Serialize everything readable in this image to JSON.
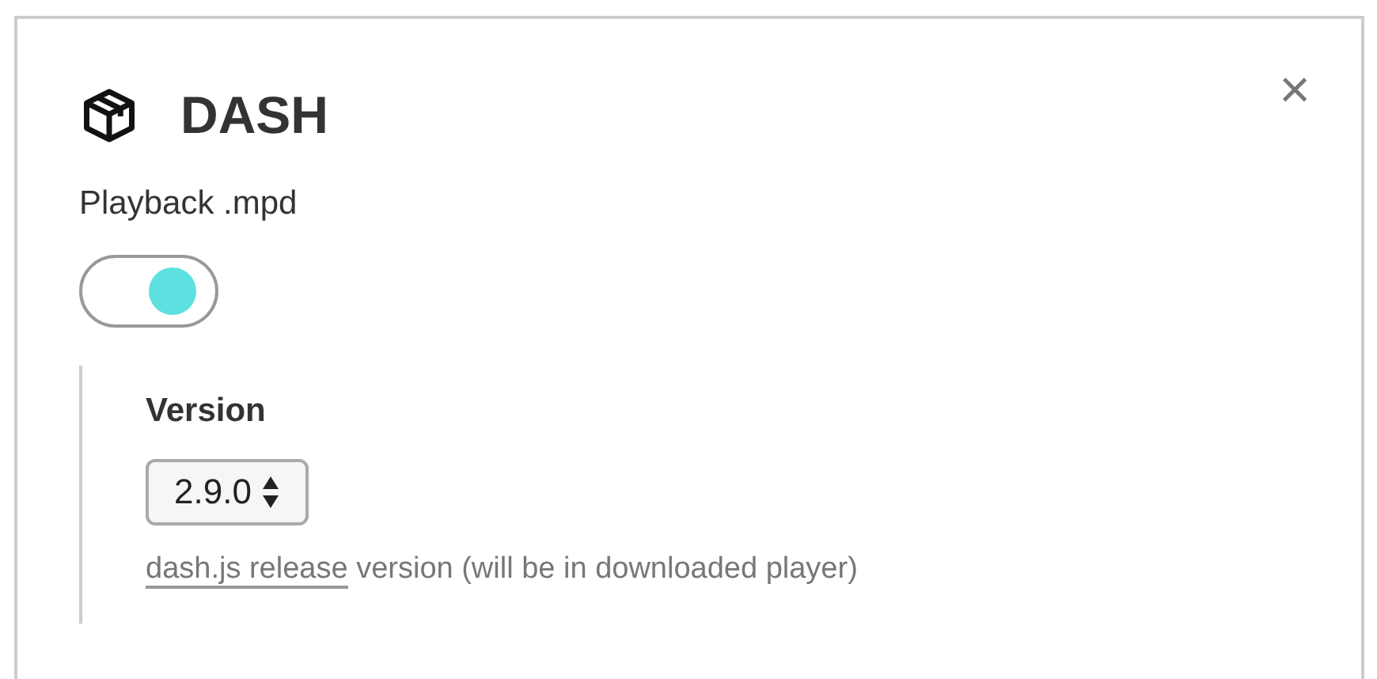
{
  "panel": {
    "title": "DASH",
    "close": "×"
  },
  "toggle": {
    "label": "Playback .mpd",
    "on": true
  },
  "version": {
    "label": "Version",
    "value": "2.9.0",
    "help_link": "dash.js release",
    "help_text": " version (will be in downloaded player)"
  }
}
